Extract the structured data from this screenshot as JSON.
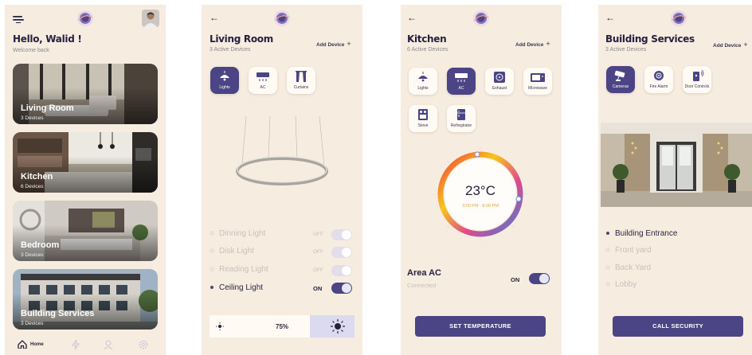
{
  "home": {
    "greeting": "Hello, Walid !",
    "welcome": "Welcome back",
    "rooms": [
      {
        "name": "Living Room",
        "count": "3 Devices"
      },
      {
        "name": "Kitchen",
        "count": "6 Devices"
      },
      {
        "name": "Bedroom",
        "count": "3 Devices"
      },
      {
        "name": "Building Services",
        "count": "3 Devices"
      }
    ],
    "nav": {
      "home_label": "Home"
    }
  },
  "living_room": {
    "title": "Living Room",
    "subtitle": "3 Active Devices",
    "add_device": "Add Device",
    "devices": [
      {
        "label": "Lights",
        "icon": "lamp-icon",
        "active": true
      },
      {
        "label": "AC",
        "icon": "ac-icon",
        "active": false
      },
      {
        "label": "Curtains",
        "icon": "curtains-icon",
        "active": false
      }
    ],
    "lights": [
      {
        "name": "Dinning Light",
        "state": "OFF"
      },
      {
        "name": "Disk Light",
        "state": "OFF"
      },
      {
        "name": "Reading Light",
        "state": "OFF"
      },
      {
        "name": "Ceiling Light",
        "state": "ON"
      }
    ],
    "brightness": "75%",
    "brightness_level": 0.75
  },
  "kitchen": {
    "title": "Kitchen",
    "subtitle": "6 Active Devices",
    "add_device": "Add Device",
    "devices": [
      {
        "label": "Lights",
        "icon": "lamp-icon",
        "active": false
      },
      {
        "label": "AC",
        "icon": "ac-icon",
        "active": true
      },
      {
        "label": "Exhaust",
        "icon": "exhaust-fan-icon",
        "active": false
      },
      {
        "label": "Microwave",
        "icon": "microwave-icon",
        "active": false
      },
      {
        "label": "Stove",
        "icon": "stove-icon",
        "active": false
      },
      {
        "label": "Refregirator",
        "icon": "refrigerator-icon",
        "active": false
      }
    ],
    "temperature": "23°C",
    "schedule": "3:00 PM - 8:00 PM",
    "area_title": "Area AC",
    "area_status": "Connected",
    "area_state": "ON",
    "button": "SET TEMPERATURE"
  },
  "building": {
    "title": "Building Services",
    "subtitle": "3 Active Devices",
    "add_device": "Add Device",
    "devices": [
      {
        "label": "Cameras",
        "icon": "camera-icon",
        "active": true
      },
      {
        "label": "Fire Alarm",
        "icon": "fire-alarm-icon",
        "active": false
      },
      {
        "label": "Door Controls",
        "icon": "door-control-icon",
        "active": false
      }
    ],
    "locations": [
      {
        "name": "Building Entrance",
        "selected": true
      },
      {
        "name": "Front yard",
        "selected": false
      },
      {
        "name": "Back Yard",
        "selected": false
      },
      {
        "name": "Lobby",
        "selected": false
      }
    ],
    "button": "CALL SECURITY"
  },
  "colors": {
    "accent": "#4c4585",
    "background": "#f7ece0"
  }
}
